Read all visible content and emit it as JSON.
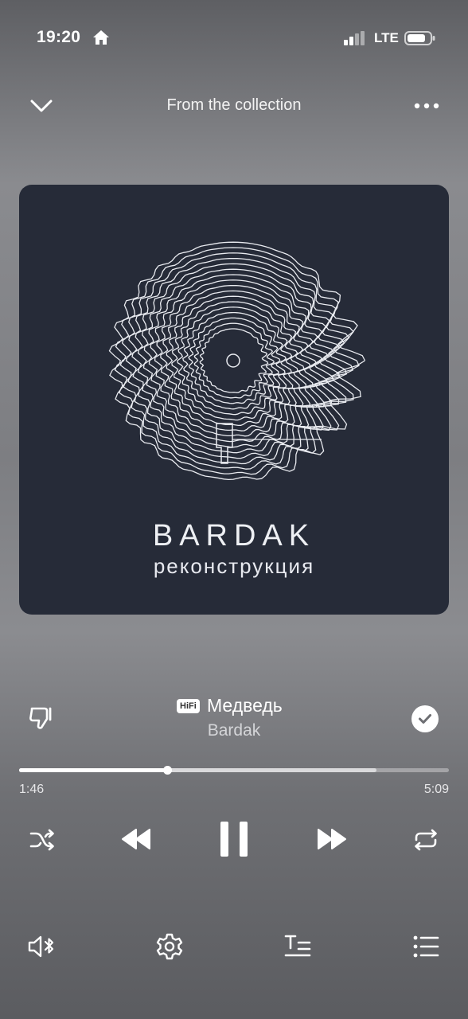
{
  "status_bar": {
    "time": "19:20",
    "network": "LTE"
  },
  "header": {
    "title": "From the collection"
  },
  "artwork": {
    "title": "BARDAK",
    "subtitle": "реконструкция"
  },
  "track": {
    "quality_badge": "HiFi",
    "title": "Медведь",
    "artist": "Bardak",
    "liked": true
  },
  "progress": {
    "elapsed": "1:46",
    "total": "5:09",
    "played_fraction": 0.344,
    "buffered_fraction": 0.832
  },
  "controls": {
    "state": "playing"
  },
  "icons": {
    "header": [
      "chevron-down-icon",
      "more-dots-icon"
    ],
    "controls": [
      "shuffle-icon",
      "rewind-icon",
      "pause-icon",
      "forward-icon",
      "repeat-icon"
    ],
    "bottom": [
      "bluetooth-speaker-icon",
      "settings-icon",
      "lyrics-icon",
      "queue-icon"
    ]
  }
}
